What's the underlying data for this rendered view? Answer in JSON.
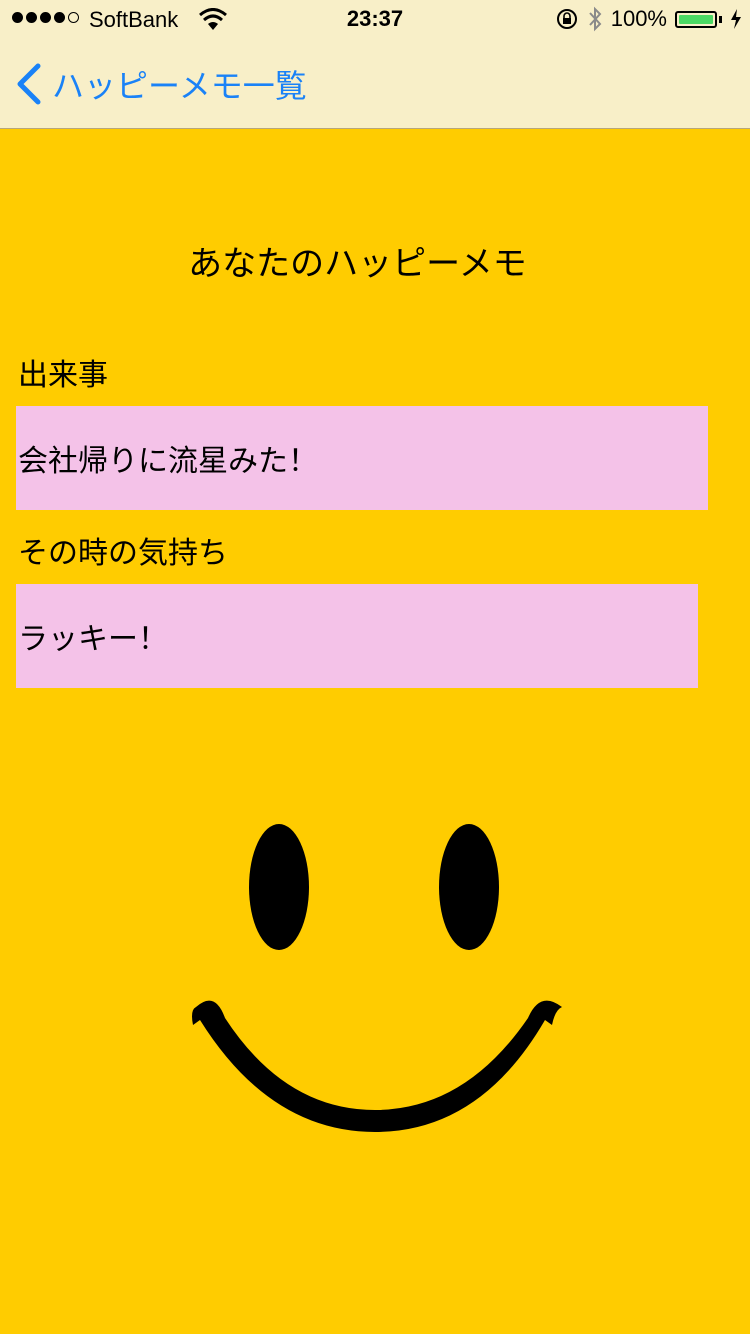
{
  "status_bar": {
    "carrier": "SoftBank",
    "time": "23:37",
    "battery_percent": "100%",
    "signal_strength": 4,
    "battery_level": 1.0
  },
  "nav": {
    "back_label": "ハッピーメモ一覧"
  },
  "page": {
    "title": "あなたのハッピーメモ",
    "event_label": "出来事",
    "event_value": "会社帰りに流星みた！",
    "feeling_label": "その時の気持ち",
    "feeling_value": "ラッキー！"
  },
  "colors": {
    "background": "#ffcc00",
    "nav_background": "#f8efc8",
    "field_background": "#f4c2e8",
    "accent": "#1a82f7",
    "battery": "#4cd964"
  },
  "icons": {
    "back": "chevron-left-icon",
    "wifi": "wifi-icon",
    "lock": "rotation-lock-icon",
    "bluetooth": "bluetooth-icon",
    "charging": "charging-bolt-icon",
    "smiley": "smiley-face-icon"
  }
}
